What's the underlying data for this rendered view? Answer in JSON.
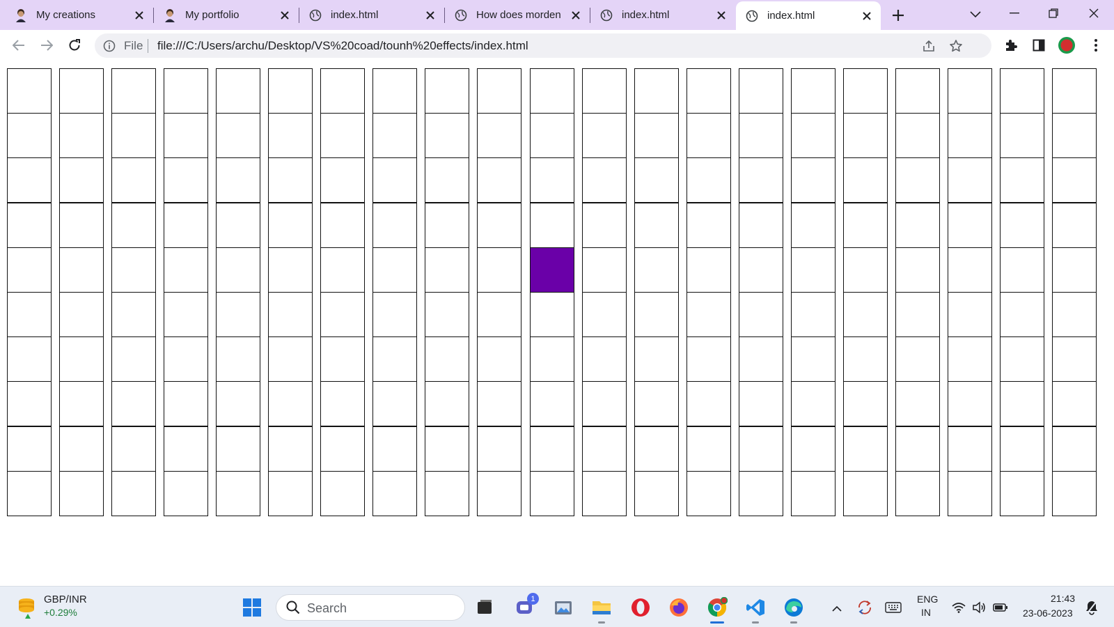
{
  "browser": {
    "tabs": [
      {
        "title": "My creations",
        "favicon": "avatar-icon",
        "active": false
      },
      {
        "title": "My portfolio",
        "favicon": "avatar-icon",
        "active": false
      },
      {
        "title": "index.html",
        "favicon": "globe-icon",
        "active": false
      },
      {
        "title": "How does morden",
        "favicon": "globe-icon",
        "active": false
      },
      {
        "title": "index.html",
        "favicon": "globe-icon",
        "active": false
      },
      {
        "title": "index.html",
        "favicon": "globe-icon",
        "active": true
      }
    ],
    "address_bar": {
      "scheme_label": "File",
      "url": "file:///C:/Users/archu/Desktop/VS%20coad/tounh%20effects/index.html"
    },
    "colors": {
      "tabstrip_bg": "#e4d4f7",
      "profile": "#d32f2f"
    }
  },
  "page": {
    "grid": {
      "columns": 21,
      "rows": 10,
      "highlighted_cell": {
        "row": 5,
        "column": 11
      },
      "cell_color": "#ffffff",
      "highlight_color": "#6a00a8",
      "border_color": "#111111"
    }
  },
  "taskbar": {
    "widget": {
      "name": "GBP/INR",
      "value": "+0.29%",
      "icon": "coins-icon"
    },
    "search_placeholder": "Search",
    "chat_badge": "1",
    "apps": [
      "windows-start-icon",
      "search-icon",
      "task-view-icon",
      "teams-chat-icon",
      "gallery-icon",
      "file-explorer-icon",
      "opera-icon",
      "firefox-icon",
      "chrome-icon",
      "vscode-icon",
      "edge-icon"
    ],
    "tray": {
      "language": "ENG",
      "region": "IN",
      "time": "21:43",
      "date": "23-06-2023"
    }
  }
}
